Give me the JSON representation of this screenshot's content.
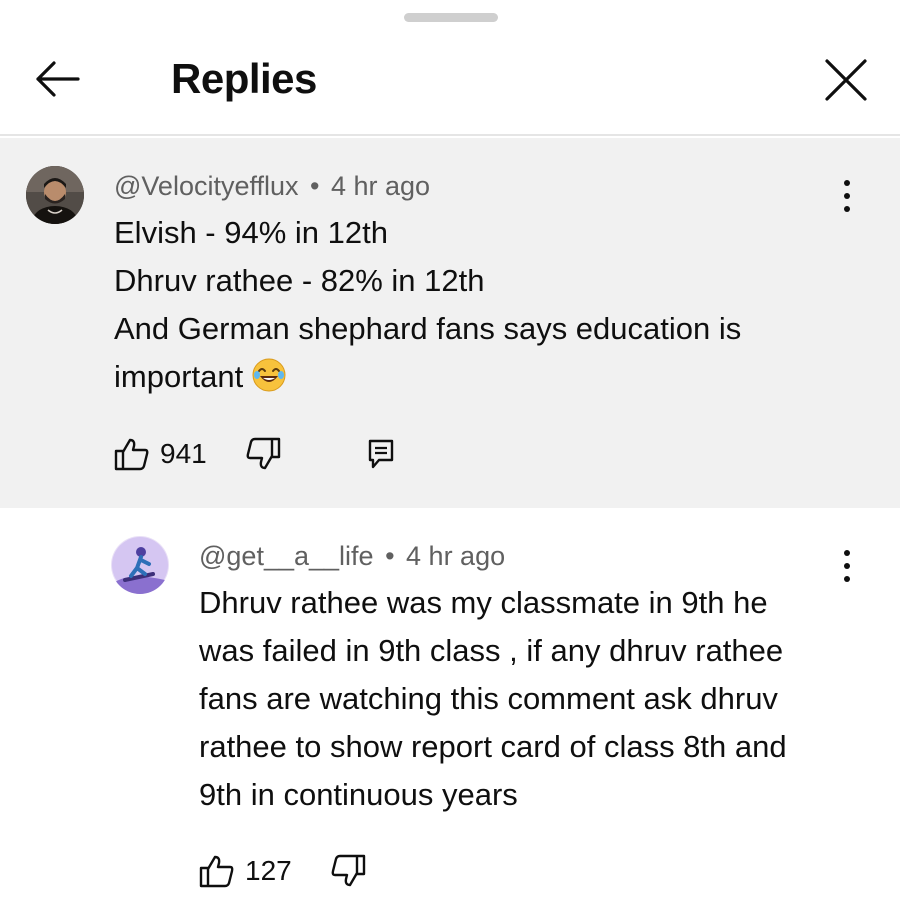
{
  "header": {
    "title": "Replies",
    "back_icon": "arrow-left-icon",
    "close_icon": "close-icon"
  },
  "parent_comment": {
    "handle": "@Velocityefflux",
    "separator": "•",
    "time": "4 hr ago",
    "lines": [
      "Elvish - 94% in 12th",
      "Dhruv rathee - 82% in 12th",
      "And German shephard fans says education is",
      "important"
    ],
    "emoji": "face-with-tears-of-joy",
    "likes": "941",
    "icons": [
      "thumbs-up-icon",
      "thumbs-down-icon",
      "reply-icon",
      "more-vertical-icon"
    ]
  },
  "reply_comment": {
    "handle": "@get__a__life",
    "separator": "•",
    "time": "4 hr ago",
    "lines": [
      "Dhruv rathee was my classmate in 9th he",
      "was failed in 9th class , if any dhruv rathee",
      "fans are watching this comment ask dhruv",
      "rathee to show report card of class 8th and",
      "9th in continuous years"
    ],
    "likes": "127",
    "icons": [
      "thumbs-up-icon",
      "thumbs-down-icon",
      "more-vertical-icon"
    ]
  },
  "colors": {
    "parent_background": "#f1f1f1",
    "meta_text": "#606060",
    "primary_text": "#0f0f0f"
  }
}
